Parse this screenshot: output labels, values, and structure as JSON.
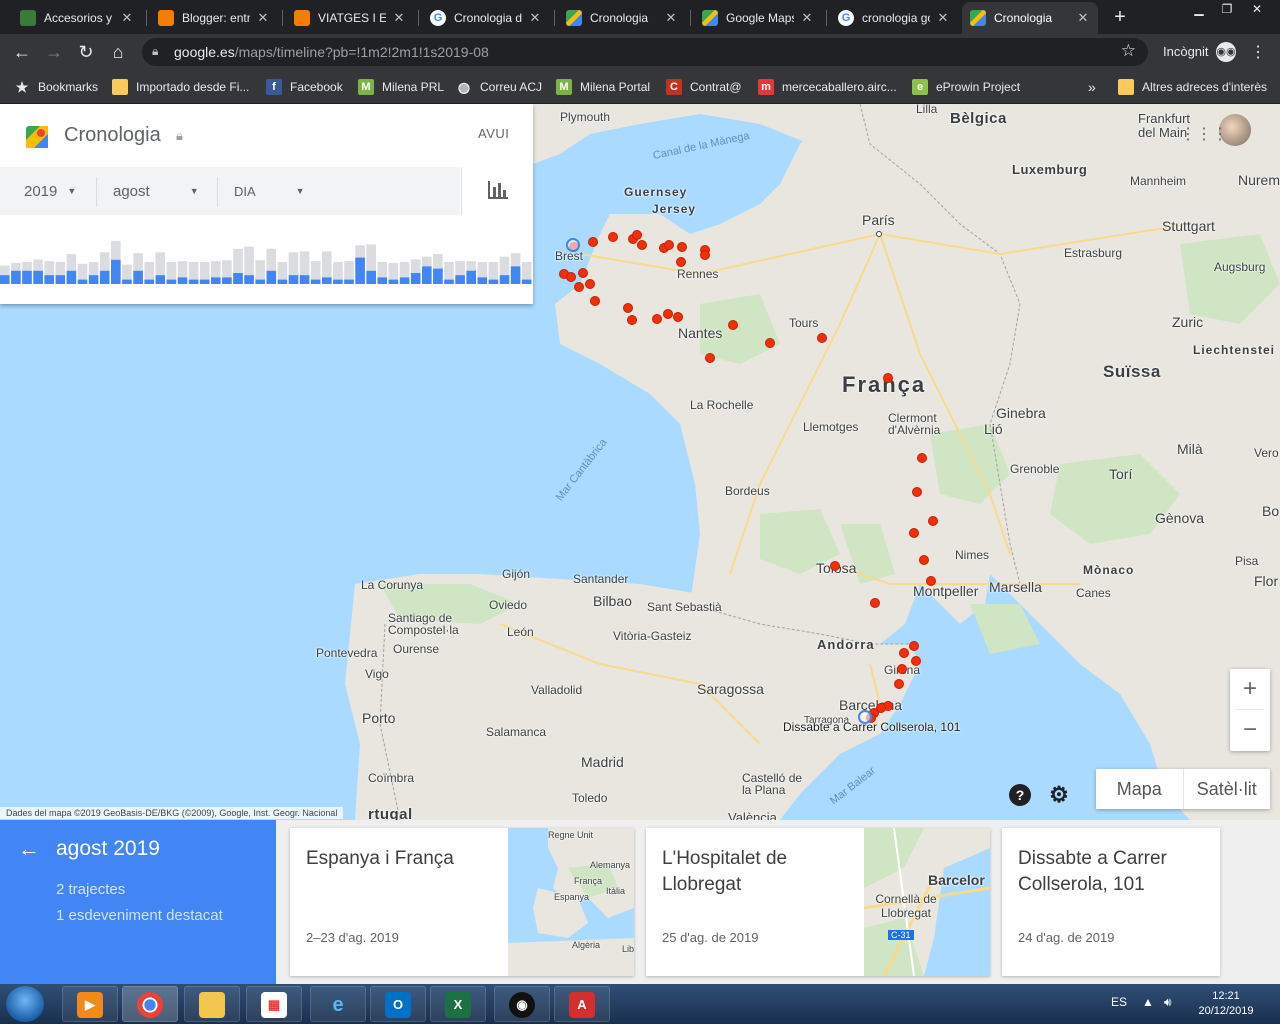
{
  "browser": {
    "tabs": [
      {
        "label": "Accesorios y l",
        "icon_color": "#3c7a3c"
      },
      {
        "label": "Blogger: entr",
        "icon_color": "#f57d00"
      },
      {
        "label": "VIATGES I ESC",
        "icon_color": "#f57d00"
      },
      {
        "label": "Cronologia de",
        "icon_color": "#4285f4"
      },
      {
        "label": "Cronologia",
        "icon_color": "#34a853"
      },
      {
        "label": "Google Maps",
        "icon_color": "#34a853"
      },
      {
        "label": "cronologia go",
        "icon_color": "#4285f4"
      },
      {
        "label": "Cronologia",
        "icon_color": "#34a853",
        "active": true
      }
    ],
    "new_tab": "+",
    "url_host": "google.es",
    "url_path": "/maps/timeline?pb=!1m2!2m1!1s2019-08",
    "incognito_label": "Incògnit",
    "bookmarks": [
      {
        "label": "Bookmarks",
        "icon": "star-icon"
      },
      {
        "label": "Importado desde Fi...",
        "icon": "folder-icon"
      },
      {
        "label": "Facebook",
        "icon": "facebook-icon",
        "color": "#3b5998",
        "glyph": "f"
      },
      {
        "label": "Milena PRL",
        "icon": "milena-icon",
        "color": "#7cb342",
        "glyph": "M"
      },
      {
        "label": "Correu ACJ",
        "icon": "globe-icon",
        "color": "#e8eaed",
        "glyph": "◍"
      },
      {
        "label": "Milena Portal",
        "icon": "milena-icon",
        "color": "#7cb342",
        "glyph": "M"
      },
      {
        "label": "Contrat@",
        "icon": "contrata-icon",
        "color": "#c6311d",
        "glyph": "C"
      },
      {
        "label": "mercecaballero.airc...",
        "icon": "aircall-icon",
        "color": "#e53935",
        "glyph": "m"
      },
      {
        "label": "eProwin Project",
        "icon": "eprowin-icon",
        "color": "#8bc34a",
        "glyph": "e"
      }
    ],
    "bookmarks_more": "»",
    "other_bookmarks": "Altres adreces d'interès"
  },
  "timeline_panel": {
    "title": "Cronologia",
    "today_button": "AVUI",
    "year": "2019",
    "month": "agost",
    "day_placeholder": "DIA",
    "bar_heights": [
      0.42,
      0.48,
      0.5,
      0.56,
      0.52,
      0.5,
      0.68,
      0.46,
      0.5,
      0.72,
      0.98,
      0.44,
      0.7,
      0.5,
      0.72,
      0.5,
      0.52,
      0.5,
      0.5,
      0.52,
      0.54,
      0.8,
      0.85,
      0.54,
      0.8,
      0.5,
      0.72,
      0.74,
      0.52,
      0.74,
      0.5,
      0.52,
      0.88,
      0.9,
      0.5,
      0.48,
      0.5,
      0.56,
      0.62,
      0.68,
      0.5,
      0.52,
      0.52,
      0.5,
      0.5,
      0.62,
      0.7,
      0.5
    ],
    "bar_highlight": [
      0.2,
      0.3,
      0.3,
      0.3,
      0.2,
      0.2,
      0.3,
      0.1,
      0.2,
      0.3,
      0.55,
      0.1,
      0.3,
      0.1,
      0.2,
      0.1,
      0.15,
      0.1,
      0.1,
      0.15,
      0.15,
      0.25,
      0.2,
      0.1,
      0.3,
      0.1,
      0.2,
      0.2,
      0.1,
      0.15,
      0.1,
      0.1,
      0.6,
      0.3,
      0.15,
      0.1,
      0.15,
      0.25,
      0.4,
      0.35,
      0.1,
      0.2,
      0.3,
      0.15,
      0.1,
      0.2,
      0.4,
      0.1
    ]
  },
  "map": {
    "labels": {
      "belgica": "Bèlgica",
      "frankfurt": "Frankfurt del Main",
      "luxemburg": "Luxemburg",
      "mannheim": "Mannheim",
      "nurem": "Nurem",
      "stuttgart": "Stuttgart",
      "estrasburg": "Estrasburg",
      "augsburg": "Augsburg",
      "zuric": "Zuric",
      "liechtenstein": "Liechtenstei",
      "suissa": "Suïssa",
      "lilla": "Lilla",
      "plymouth": "Plymouth",
      "canal": "Canal de la Mànega",
      "guernsey": "Guernsey",
      "jersey": "Jersey",
      "paris": "París",
      "brest": "Brest",
      "rennes": "Rennes",
      "tours": "Tours",
      "nantes": "Nantes",
      "franca": "França",
      "larochelle": "La Rochelle",
      "llemotges": "Llemotges",
      "clermont": "Clermont d'Alvèrnia",
      "ginebra": "Ginebra",
      "lio": "Lió",
      "mila": "Milà",
      "verona": "Vero",
      "grenoble": "Grenoble",
      "tori": "Torí",
      "genova": "Gènova",
      "bol": "Bo",
      "bordeus": "Bordeus",
      "mar_cantabrica": "Mar Cantàbrica",
      "nimes": "Nimes",
      "pisa": "Pisa",
      "flor": "Flor",
      "monaco": "Mònaco",
      "tolosa": "Tolosa",
      "montpeller": "Montpeller",
      "marsella": "Marsella",
      "canes": "Canes",
      "lacorunya": "La Corunya",
      "gijon": "Gijón",
      "santander": "Santander",
      "bilbao": "Bilbao",
      "santsebastia": "Sant Sebastià",
      "oviedo": "Oviedo",
      "santiago": "Santiago de Compostel·la",
      "leon": "León",
      "vitoria": "Vitòria-Gasteiz",
      "andorra": "Andorra",
      "pontevedra": "Pontevedra",
      "ourense": "Ourense",
      "vigo": "Vigo",
      "girona": "Girona",
      "valladolid": "Valladolid",
      "saragossa": "Saragossa",
      "barcelona": "Barcelona",
      "tarragona": "Tarragona",
      "dissabte": "Dissabte a Carrer Collserola, 101",
      "porto": "Porto",
      "salamanca": "Salamanca",
      "madrid": "Madrid",
      "coimbra": "Coïmbra",
      "castello": "Castelló de la Plana",
      "mar_balear": "Mar Balear",
      "toledo": "Toledo",
      "valencia": "València",
      "portugal": "rtugal"
    },
    "attribution": "Dades del mapa ©2019 GeoBasis-DE/BKG (©2009), Google, Inst. Geogr. Nacional",
    "zoom_in": "+",
    "zoom_out": "−",
    "help": "?",
    "settings": "⚙",
    "map_type_map": "Mapa",
    "map_type_satellite": "Satèl·lit",
    "visit_color": "#f12f0d"
  },
  "summary": {
    "month": "agost 2019",
    "trips": "2 trajectes",
    "events": "1 esdeveniment destacat"
  },
  "cards": [
    {
      "title": "Espanya i França",
      "date": "2–23 d'ag. 2019",
      "thumb_labels": {
        "uk": "Regne Unit",
        "de": "Alemanya",
        "fr": "França",
        "it": "Itàlia",
        "es": "Espanya",
        "dz": "Algèria",
        "ly": "Lib"
      }
    },
    {
      "title": "L'Hospitalet de Llobregat",
      "date": "25 d'ag. de 2019",
      "thumb_labels": {
        "bcn": "Barcelor",
        "cornella": "Cornellà de Llobregat",
        "road": "C-31"
      }
    },
    {
      "title": "Dissabte a Carrer Collserola, 101",
      "date": "24 d'ag. de 2019"
    }
  ],
  "taskbar": {
    "lang": "ES",
    "time": "12:21",
    "date": "20/12/2019"
  }
}
